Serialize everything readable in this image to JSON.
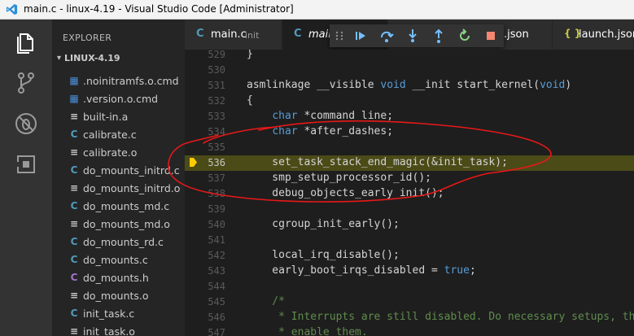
{
  "window": {
    "title": "main.c - linux-4.19 - Visual Studio Code [Administrator]"
  },
  "activity_bar": {
    "icons": [
      "files-icon",
      "source-control-icon",
      "debug-icon",
      "extensions-icon"
    ]
  },
  "sidebar": {
    "header": "EXPLORER",
    "folder": "LINUX-4.19",
    "files": [
      {
        "name": ".noinitramfs.o.cmd",
        "icon": "windows-file-icon",
        "glyph": "▦"
      },
      {
        "name": ".version.o.cmd",
        "icon": "windows-file-icon",
        "glyph": "▦"
      },
      {
        "name": "built-in.a",
        "icon": "text-file-icon",
        "glyph": "≡"
      },
      {
        "name": "calibrate.c",
        "icon": "c-file-icon",
        "glyph": "C"
      },
      {
        "name": "calibrate.o",
        "icon": "text-file-icon",
        "glyph": "≡"
      },
      {
        "name": "do_mounts_initrd.c",
        "icon": "c-file-icon",
        "glyph": "C"
      },
      {
        "name": "do_mounts_initrd.o",
        "icon": "text-file-icon",
        "glyph": "≡"
      },
      {
        "name": "do_mounts_md.c",
        "icon": "c-file-icon",
        "glyph": "C"
      },
      {
        "name": "do_mounts_md.o",
        "icon": "text-file-icon",
        "glyph": "≡"
      },
      {
        "name": "do_mounts_rd.c",
        "icon": "c-file-icon",
        "glyph": "C"
      },
      {
        "name": "do_mounts.c",
        "icon": "c-file-icon",
        "glyph": "C"
      },
      {
        "name": "do_mounts.h",
        "icon": "h-file-icon",
        "glyph": "C"
      },
      {
        "name": "do_mounts.o",
        "icon": "text-file-icon",
        "glyph": "≡"
      },
      {
        "name": "init_task.c",
        "icon": "c-file-icon",
        "glyph": "C"
      },
      {
        "name": "init_task.o",
        "icon": "text-file-icon",
        "glyph": "≡"
      }
    ]
  },
  "tabs": [
    {
      "label": "main.c",
      "description": "init",
      "icon_glyph": "C",
      "active": false
    },
    {
      "label": "main",
      "description": "",
      "icon_glyph": "C",
      "active": true
    },
    {
      "label": ".json",
      "description": "",
      "icon_glyph": "",
      "active": false
    },
    {
      "label": "launch.json",
      "description": "",
      "icon_glyph": "{ }",
      "active": false
    }
  ],
  "debug_toolbar": [
    "drag-handle-icon",
    "continue-icon",
    "step-over-icon",
    "step-into-icon",
    "step-out-icon",
    "restart-icon",
    "stop-icon"
  ],
  "editor": {
    "current_line": 536,
    "lines": [
      {
        "n": "529",
        "code": "}"
      },
      {
        "n": "530",
        "code": ""
      },
      {
        "n": "531",
        "code": "asmlinkage __visible void __init start_kernel(void)"
      },
      {
        "n": "532",
        "code": "{"
      },
      {
        "n": "533",
        "code": "    char *command_line;"
      },
      {
        "n": "534",
        "code": "    char *after_dashes;"
      },
      {
        "n": "535",
        "code": ""
      },
      {
        "n": "536",
        "code": "    set_task_stack_end_magic(&init_task);"
      },
      {
        "n": "537",
        "code": "    smp_setup_processor_id();"
      },
      {
        "n": "538",
        "code": "    debug_objects_early_init();"
      },
      {
        "n": "539",
        "code": ""
      },
      {
        "n": "540",
        "code": "    cgroup_init_early();"
      },
      {
        "n": "541",
        "code": ""
      },
      {
        "n": "542",
        "code": "    local_irq_disable();"
      },
      {
        "n": "543",
        "code": "    early_boot_irqs_disabled = true;"
      },
      {
        "n": "544",
        "code": ""
      },
      {
        "n": "545",
        "code": "    /*"
      },
      {
        "n": "546",
        "code": "     * Interrupts are still disabled. Do necessary setups, the"
      },
      {
        "n": "547",
        "code": "     * enable them."
      }
    ]
  },
  "colors": {
    "accent": "#0e639c",
    "highlight_line": "#4b4b18",
    "annotation": "#e81818",
    "debug_blue": "#75beff",
    "debug_green": "#89d185",
    "debug_red": "#f48771"
  }
}
